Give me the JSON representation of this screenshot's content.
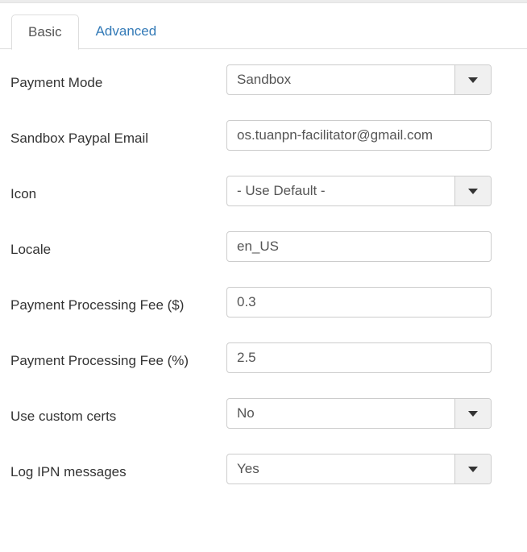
{
  "colors": {
    "accent_link": "#337ab7",
    "label_text": "#333333",
    "value_text": "#555555",
    "border": "#cccccc",
    "tab_border": "#dddddd",
    "button_face": "#f0f0f0",
    "top_band": "#ececec"
  },
  "tabs": [
    {
      "label": "Basic",
      "active": true
    },
    {
      "label": "Advanced",
      "active": false
    }
  ],
  "form": {
    "rows": [
      {
        "label": "Payment Mode",
        "control": "select",
        "value": "Sandbox",
        "name": "payment-mode"
      },
      {
        "label": "Sandbox Paypal Email",
        "control": "text",
        "value": "os.tuanpn-facilitator@gmail.com",
        "name": "sandbox-paypal-email"
      },
      {
        "label": "Icon",
        "control": "select",
        "value": "- Use Default -",
        "name": "icon"
      },
      {
        "label": "Locale",
        "control": "text",
        "value": "en_US",
        "name": "locale"
      },
      {
        "label": "Payment Processing Fee ($)",
        "control": "text",
        "value": "0.3",
        "name": "payment-processing-fee-dollar"
      },
      {
        "label": "Payment Processing Fee (%)",
        "control": "text",
        "value": "2.5",
        "name": "payment-processing-fee-percent"
      },
      {
        "label": "Use custom certs",
        "control": "select",
        "value": "No",
        "name": "use-custom-certs"
      },
      {
        "label": "Log IPN messages",
        "control": "select",
        "value": "Yes",
        "name": "log-ipn-messages"
      }
    ]
  },
  "icons": {
    "dropdown_caret": "chevron-down-icon"
  }
}
